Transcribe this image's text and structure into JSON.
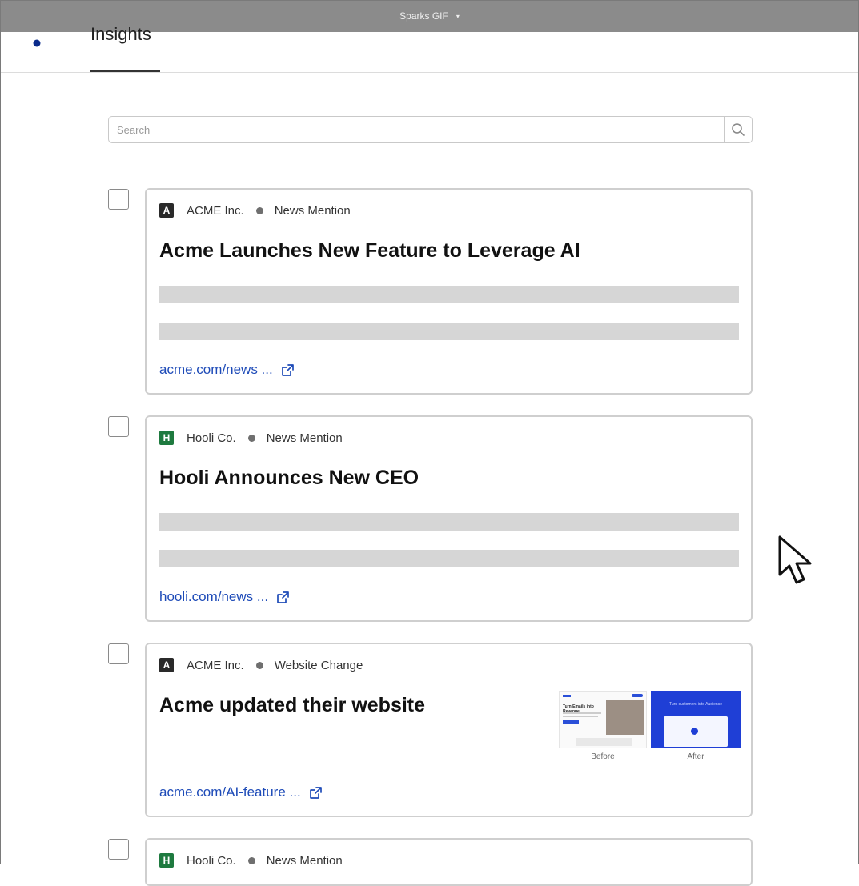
{
  "window": {
    "title": "Sparks GIF"
  },
  "nav": {
    "active_tab": "Insights"
  },
  "search": {
    "placeholder": "Search"
  },
  "cards": [
    {
      "company": "ACME Inc.",
      "company_initial": "A",
      "company_color": "#2a2a2a",
      "type": "News Mention",
      "title": "Acme Launches New Feature to Leverage AI",
      "link": "acme.com/news ..."
    },
    {
      "company": "Hooli Co.",
      "company_initial": "H",
      "company_color": "#1e7a3f",
      "type": "News Mention",
      "title": "Hooli Announces New CEO",
      "link": "hooli.com/news ..."
    },
    {
      "company": "ACME Inc.",
      "company_initial": "A",
      "company_color": "#2a2a2a",
      "type": "Website Change",
      "title": "Acme updated their website",
      "link": "acme.com/AI-feature ...",
      "comparison": {
        "before_label": "Before",
        "after_label": "After",
        "before_text": "Turn Emails into Revenue",
        "after_text": "Turn customers into Audience"
      }
    },
    {
      "company": "Hooli Co.",
      "company_initial": "H",
      "company_color": "#1e7a3f",
      "type": "News Mention"
    }
  ],
  "icons": {
    "logo": "sparks-logo-icon",
    "search": "search-icon",
    "external_link": "external-link-icon",
    "cursor": "mouse-pointer-icon"
  }
}
